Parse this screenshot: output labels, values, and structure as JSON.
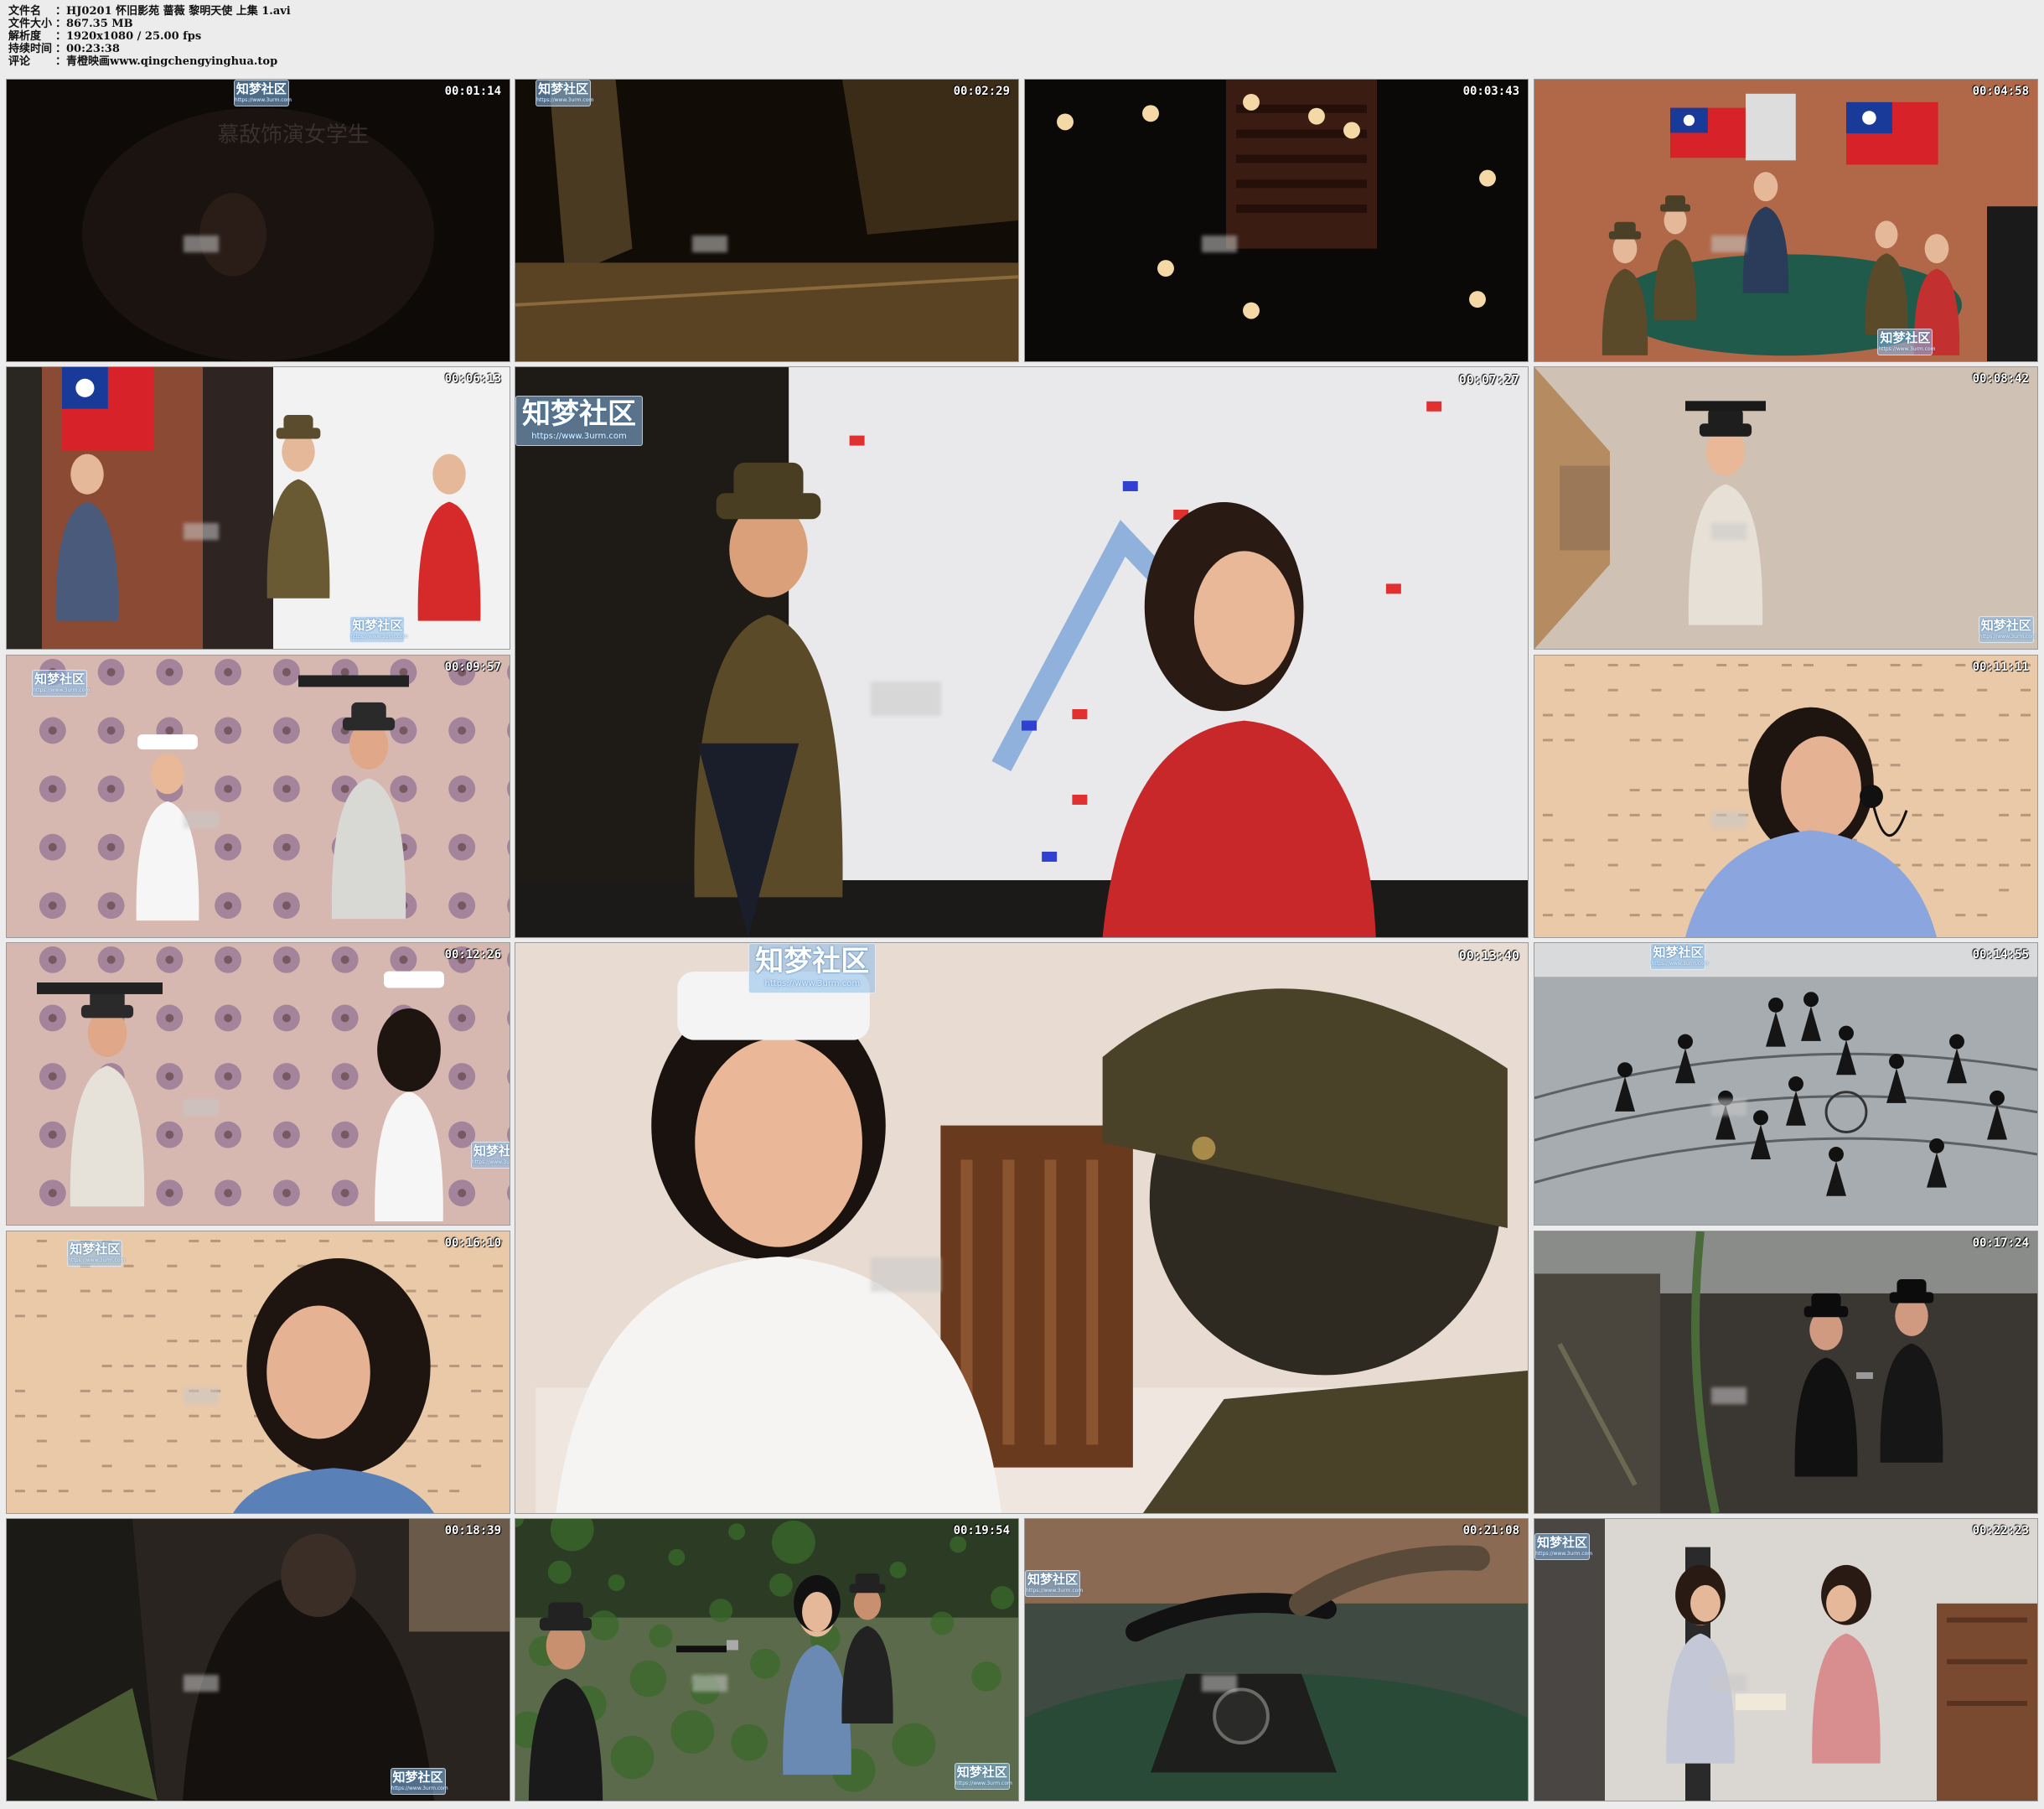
{
  "file_info": [
    {
      "key": "文件名",
      "value": "：HJ0201 怀旧影苑 蔷薇 黎明天使 上集 1.avi"
    },
    {
      "key": "文件大小",
      "value": "：867.35 MB"
    },
    {
      "key": "解析度",
      "value": "：1920x1080 / 25.00 fps"
    },
    {
      "key": "持续时间",
      "value": "：00:23:38"
    },
    {
      "key": "评论",
      "value": "：青橙映画www.qingchengyinghua.top"
    }
  ],
  "watermark": {
    "text": "知梦社区",
    "url": "https://www.3urm.com"
  },
  "frame1_caption": "慕敌饰演女学生",
  "thumbnails": [
    {
      "time": "00:01:14",
      "scene": "dark-title"
    },
    {
      "time": "00:02:29",
      "scene": "dark-ruins"
    },
    {
      "time": "00:03:43",
      "scene": "dark-lights"
    },
    {
      "time": "00:04:58",
      "scene": "meeting-room"
    },
    {
      "time": "00:06:13",
      "scene": "officers-flag"
    },
    {
      "time": "00:07:27",
      "scene": "officer-woman-map"
    },
    {
      "time": "00:08:42",
      "scene": "hat-man-corridor"
    },
    {
      "time": "00:09:57",
      "scene": "nurse-curtain"
    },
    {
      "time": "00:11:11",
      "scene": "woman-phone"
    },
    {
      "time": "00:12:26",
      "scene": "man-nurse-curtain"
    },
    {
      "time": "00:13:40",
      "scene": "nurse-officer"
    },
    {
      "time": "00:14:55",
      "scene": "street-chase"
    },
    {
      "time": "00:16:10",
      "scene": "woman-calligraphy"
    },
    {
      "time": "00:17:24",
      "scene": "alley-gun"
    },
    {
      "time": "00:18:39",
      "scene": "dark-figures"
    },
    {
      "time": "00:19:54",
      "scene": "garden-gun"
    },
    {
      "time": "00:21:08",
      "scene": "telephone"
    },
    {
      "time": "00:22:23",
      "scene": "two-women-office"
    }
  ]
}
